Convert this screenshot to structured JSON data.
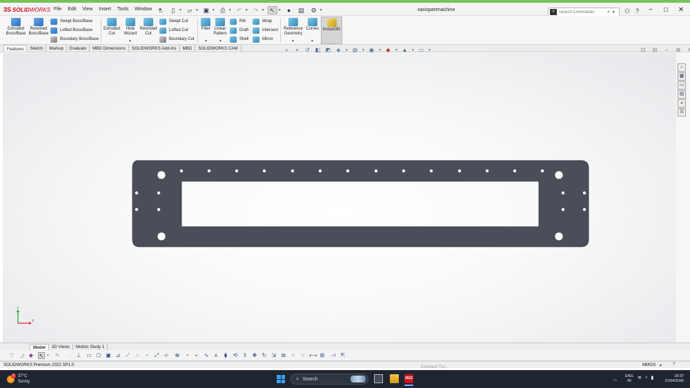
{
  "app": {
    "logo_ds": "3S",
    "logo_solid": "SOLID",
    "logo_works": "WORKS",
    "document_title": "xaxispartmachine"
  },
  "menu": [
    "File",
    "Edit",
    "View",
    "Insert",
    "Tools",
    "Window"
  ],
  "search": {
    "placeholder": "Search Commands"
  },
  "ribbon": {
    "extruded_boss": [
      "Extruded",
      "Boss/Base"
    ],
    "revolved_boss": [
      "Revolved",
      "Boss/Base"
    ],
    "swept_boss": "Swept Boss/Base",
    "lofted_boss": "Lofted Boss/Base",
    "boundary_boss": "Boundary Boss/Base",
    "extruded_cut": [
      "Extruded",
      "Cut"
    ],
    "hole_wizard": [
      "Hole",
      "Wizard"
    ],
    "revolved_cut": [
      "Revolved",
      "Cut"
    ],
    "swept_cut": "Swept Cut",
    "lofted_cut": "Lofted Cut",
    "boundary_cut": "Boundary Cut",
    "fillet": "Fillet",
    "linear_pattern": [
      "Linear",
      "Pattern"
    ],
    "rib": "Rib",
    "draft": "Draft",
    "shell": "Shell",
    "wrap": "Wrap",
    "intersect": "Intersect",
    "mirror": "Mirror",
    "reference_geometry": [
      "Reference",
      "Geometry"
    ],
    "curves": "Curves",
    "instant3d": "Instant3D"
  },
  "command_tabs": [
    "Features",
    "Sketch",
    "Markup",
    "Evaluate",
    "MBD Dimensions",
    "SOLIDWORKS Add-Ins",
    "MBD",
    "SOLIDWORKS CAM"
  ],
  "bottom_tabs": [
    "Model",
    "3D Views",
    "Motion Study 1"
  ],
  "triad": {
    "x": "X",
    "y": "Y"
  },
  "status": {
    "product": "SOLIDWORKS Premium 2022 SP1.0",
    "units": "MMGS",
    "ghost_text": "Connect Tur..."
  },
  "taskbar": {
    "temperature": "37°C",
    "condition": "Sunny",
    "weather_badge": "1",
    "search_label": "Search",
    "sw_icon_label": "2022",
    "lang_line1": "ENG",
    "lang_line2": "IN",
    "time": "18:37",
    "date": "21/04/2026"
  },
  "colors": {
    "part_fill": "#4b4e58",
    "accent_green": "#78c257",
    "brand_red": "#d6001c"
  }
}
